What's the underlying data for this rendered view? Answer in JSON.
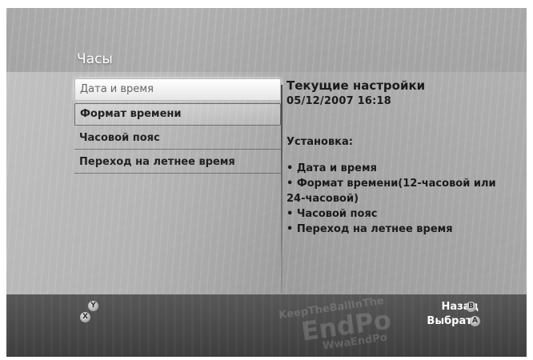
{
  "header": {
    "title": "Часы"
  },
  "menu": {
    "items": [
      {
        "label": "Дата и время"
      },
      {
        "label": "Формат времени"
      },
      {
        "label": "Часовой пояс"
      },
      {
        "label": "Переход на летнее время"
      }
    ]
  },
  "info": {
    "heading": "Текущие настройки",
    "datetime": "05/12/2007  16:18",
    "setup_label": "Установка:",
    "list": [
      "• Дата и время",
      "• Формат времени(12-часовой или",
      "24-часовой)",
      "• Часовой пояс",
      "• Переход на летнее время"
    ]
  },
  "footer": {
    "buttons": {
      "y": "Y",
      "x": "X",
      "b": "B",
      "a": "A"
    },
    "back_label": "Назад",
    "select_label": "Выбрать",
    "watermark": [
      "KeepTheBallInThe",
      "EndPo",
      "WwaEndPo"
    ]
  },
  "colors": {
    "footer_bg": "#4a4a4a",
    "active_item_bg": "#f2f2f2"
  }
}
